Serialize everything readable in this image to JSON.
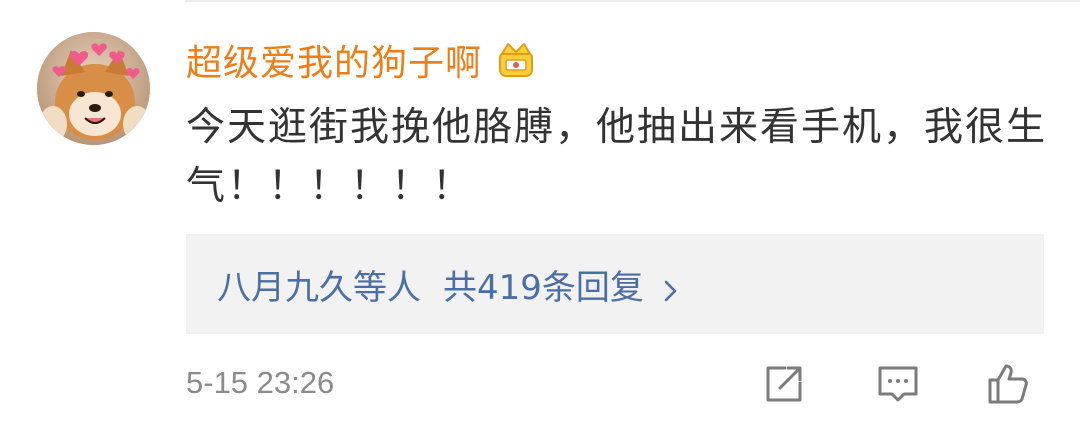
{
  "comment": {
    "username": "超级爱我的狗子啊",
    "crown_icon": "crown-badge-icon",
    "text": "今天逛街我挽他胳膊，他抽出来看手机，我很生气！！！！！！",
    "replies": {
      "names": "八月九久",
      "suffix": "等人",
      "total": "共419条回复"
    },
    "timestamp": "5-15 23:26",
    "actions": [
      "share-icon",
      "comment-icon",
      "like-icon"
    ]
  },
  "colors": {
    "username": "#ee7d17",
    "link": "#4a6fa5",
    "text": "#333333",
    "meta": "#8b8b8b",
    "reply_bg": "#f2f2f2"
  }
}
